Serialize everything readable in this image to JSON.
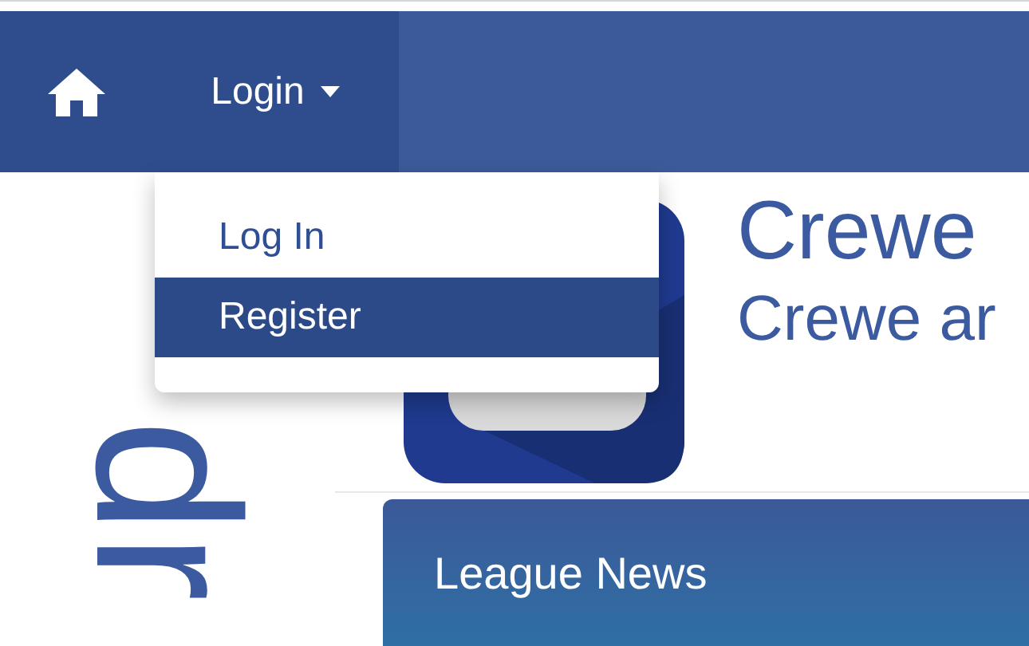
{
  "navbar": {
    "items": [
      {
        "kind": "home"
      },
      {
        "kind": "dropdown",
        "label": "Login",
        "expanded": true
      }
    ]
  },
  "dropdown_menu": {
    "items": [
      {
        "label": "Log In",
        "selected": false
      },
      {
        "label": "Register",
        "selected": true
      }
    ]
  },
  "side_text": "dr",
  "header": {
    "title": "Crewe",
    "subtitle": "Crewe ar"
  },
  "panel": {
    "title": "League News"
  }
}
